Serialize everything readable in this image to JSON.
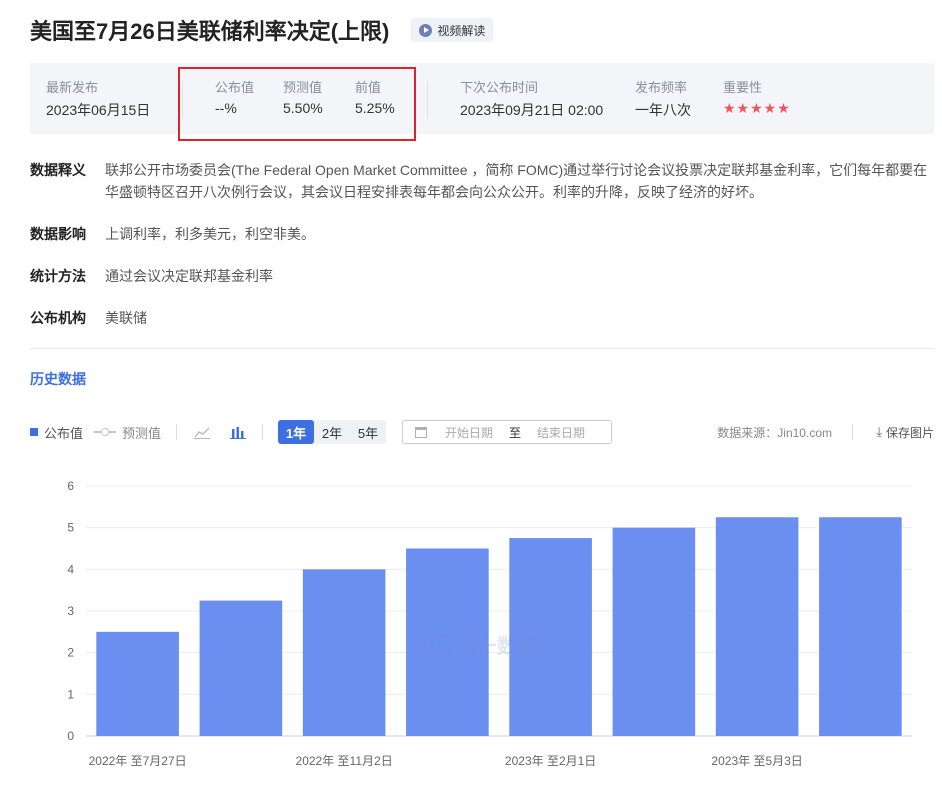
{
  "header": {
    "title": "美国至7月26日美联储利率决定(上限)",
    "video_label": "视频解读"
  },
  "info": {
    "latest_label": "最新发布",
    "latest_value": "2023年06月15日",
    "actual_label": "公布值",
    "actual_value": "--%",
    "forecast_label": "预测值",
    "forecast_value": "5.50%",
    "previous_label": "前值",
    "previous_value": "5.25%",
    "next_label": "下次公布时间",
    "next_value": "2023年09月21日 02:00",
    "freq_label": "发布频率",
    "freq_value": "一年八次",
    "importance_label": "重要性",
    "importance_stars": "★★★★★",
    "importance_level": 5
  },
  "description": [
    {
      "label": "数据释义",
      "text": "联邦公开市场委员会(The Federal Open Market Committee ，简称 FOMC)通过举行讨论会议投票决定联邦基金利率，它们每年都要在华盛顿特区召开八次例行会议，其会议日程安排表每年都会向公众公开。利率的升降，反映了经济的好坏。"
    },
    {
      "label": "数据影响",
      "text": "上调利率，利多美元，利空非美。"
    },
    {
      "label": "统计方法",
      "text": "通过会议决定联邦基金利率"
    },
    {
      "label": "公布机构",
      "text": "美联储"
    }
  ],
  "history": {
    "title": "历史数据",
    "legend_actual": "公布值",
    "legend_forecast": "预测值",
    "periods": [
      "1年",
      "2年",
      "5年"
    ],
    "active_period": "1年",
    "start_placeholder": "开始日期",
    "to_label": "至",
    "end_placeholder": "结束日期",
    "source_text": "数据来源：Jin10.com",
    "save_label": "保存图片",
    "watermark": "金十数据"
  },
  "colors": {
    "accent": "#3d6fe0",
    "bar": "#6b8ff0",
    "star": "#f5525b",
    "highlight_box": "#d9262c"
  },
  "chart_data": {
    "type": "bar",
    "series": [
      {
        "name": "公布值",
        "values": [
          2.5,
          3.25,
          4.0,
          4.5,
          4.75,
          5.0,
          5.25,
          5.25
        ]
      }
    ],
    "x_tick_labels": [
      "2022年 至7月27日",
      "2022年 至11月2日",
      "2023年 至2月1日",
      "2023年 至5月3日"
    ],
    "y_ticks": [
      0,
      1,
      2,
      3,
      4,
      5,
      6
    ],
    "ylim": [
      0,
      6
    ],
    "grid": true,
    "legend": "top-left"
  }
}
